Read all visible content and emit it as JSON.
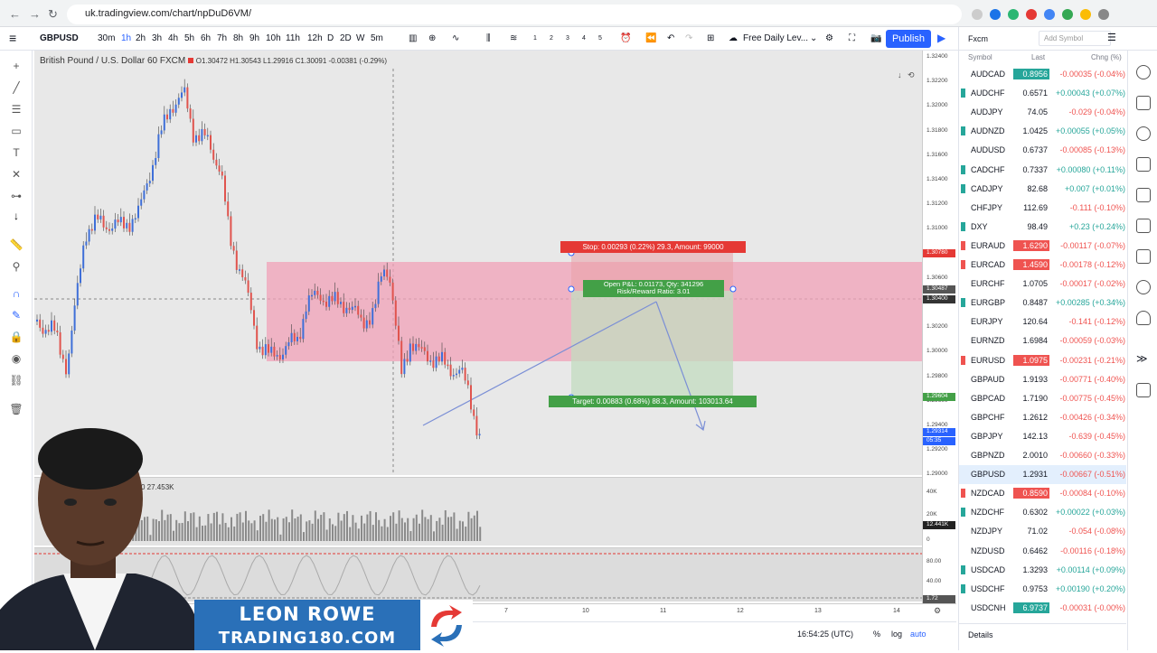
{
  "browser": {
    "url": "uk.tradingview.com/chart/npDuD6VM/"
  },
  "toolbar": {
    "symbol": "GBPUSD",
    "intervals": [
      "30m",
      "1h",
      "2h",
      "3h",
      "4h",
      "5h",
      "6h",
      "7h",
      "8h",
      "9h",
      "10h",
      "11h",
      "12h",
      "D",
      "2D",
      "W",
      "5m"
    ],
    "mini_numbers": [
      "1",
      "2",
      "3",
      "4",
      "5"
    ],
    "layout_name": "Free Daily Lev...",
    "publish": "Publish"
  },
  "chart": {
    "title": "British Pound / U.S. Dollar",
    "interval": "60",
    "exchange": "FXCM",
    "ohlc": "O1.30472 H1.30543 L1.29916 C1.30091 -0.00381 (-0.29%)",
    "stop_label": "Stop: 0.00293 (0.22%) 29.3, Amount: 99000",
    "pnl_label": "Open P&L: 0.01173, Qty: 341296",
    "rr_label": "Risk/Reward Ratio: 3.01",
    "target_label": "Target: 0.00883 (0.68%) 88.3, Amount: 103013.64",
    "volume_label": "D 0 27.453K"
  },
  "yaxis": {
    "ticks": [
      "1.32400",
      "1.32200",
      "1.32000",
      "1.31800",
      "1.31600",
      "1.31400",
      "1.31200",
      "1.31000",
      "1.30800",
      "1.30600",
      "1.30400",
      "1.30200",
      "1.30000",
      "1.29800",
      "1.29600",
      "1.29400",
      "1.29200",
      "1.29000"
    ],
    "stop_badge": "1.30780",
    "entry_badge": "1.30487",
    "cross_badge": "1.30400",
    "target_badge": "1.29604",
    "price_badge": "1.29314",
    "countdown": "05:35",
    "vol_ticks": [
      "40K",
      "20K",
      "0"
    ],
    "vol_badge": "12.441K",
    "osc_ticks": [
      "80.00",
      "40.00",
      "1.72"
    ]
  },
  "xaxis": {
    "ticks": [
      "7",
      "10",
      "11",
      "12",
      "13",
      "14"
    ]
  },
  "status": {
    "time": "16:54:25 (UTC)",
    "pct": "%",
    "log": "log",
    "auto": "auto"
  },
  "watchlist": {
    "title": "Fxcm",
    "add": "Add Symbol",
    "col_symbol": "Symbol",
    "col_last": "Last",
    "col_chng": "Chng (%)",
    "details": "Details",
    "rows": [
      {
        "s": "AUDCAD",
        "l": "0.8956",
        "c": "-0.00035 (-0.04%)",
        "d": "dn",
        "hl": "up"
      },
      {
        "s": "AUDCHF",
        "l": "0.6571",
        "c": "+0.00043 (+0.07%)",
        "d": "up",
        "hl": ""
      },
      {
        "s": "AUDJPY",
        "l": "74.05",
        "c": "-0.029 (-0.04%)",
        "d": "dn",
        "hl": ""
      },
      {
        "s": "AUDNZD",
        "l": "1.0425",
        "c": "+0.00055 (+0.05%)",
        "d": "up",
        "hl": ""
      },
      {
        "s": "AUDUSD",
        "l": "0.6737",
        "c": "-0.00085 (-0.13%)",
        "d": "dn",
        "hl": ""
      },
      {
        "s": "CADCHF",
        "l": "0.7337",
        "c": "+0.00080 (+0.11%)",
        "d": "up",
        "hl": ""
      },
      {
        "s": "CADJPY",
        "l": "82.68",
        "c": "+0.007 (+0.01%)",
        "d": "up",
        "hl": ""
      },
      {
        "s": "CHFJPY",
        "l": "112.69",
        "c": "-0.111 (-0.10%)",
        "d": "dn",
        "hl": ""
      },
      {
        "s": "DXY",
        "l": "98.49",
        "c": "+0.23 (+0.24%)",
        "d": "up",
        "hl": ""
      },
      {
        "s": "EURAUD",
        "l": "1.6290",
        "c": "-0.00117 (-0.07%)",
        "d": "dn",
        "hl": "dn"
      },
      {
        "s": "EURCAD",
        "l": "1.4590",
        "c": "-0.00178 (-0.12%)",
        "d": "dn",
        "hl": "dn"
      },
      {
        "s": "EURCHF",
        "l": "1.0705",
        "c": "-0.00017 (-0.02%)",
        "d": "dn",
        "hl": ""
      },
      {
        "s": "EURGBP",
        "l": "0.8487",
        "c": "+0.00285 (+0.34%)",
        "d": "up",
        "hl": ""
      },
      {
        "s": "EURJPY",
        "l": "120.64",
        "c": "-0.141 (-0.12%)",
        "d": "dn",
        "hl": ""
      },
      {
        "s": "EURNZD",
        "l": "1.6984",
        "c": "-0.00059 (-0.03%)",
        "d": "dn",
        "hl": ""
      },
      {
        "s": "EURUSD",
        "l": "1.0975",
        "c": "-0.00231 (-0.21%)",
        "d": "dn",
        "hl": "dn"
      },
      {
        "s": "GBPAUD",
        "l": "1.9193",
        "c": "-0.00771 (-0.40%)",
        "d": "dn",
        "hl": ""
      },
      {
        "s": "GBPCAD",
        "l": "1.7190",
        "c": "-0.00775 (-0.45%)",
        "d": "dn",
        "hl": ""
      },
      {
        "s": "GBPCHF",
        "l": "1.2612",
        "c": "-0.00426 (-0.34%)",
        "d": "dn",
        "hl": ""
      },
      {
        "s": "GBPJPY",
        "l": "142.13",
        "c": "-0.639 (-0.45%)",
        "d": "dn",
        "hl": ""
      },
      {
        "s": "GBPNZD",
        "l": "2.0010",
        "c": "-0.00660 (-0.33%)",
        "d": "dn",
        "hl": ""
      },
      {
        "s": "GBPUSD",
        "l": "1.2931",
        "c": "-0.00667 (-0.51%)",
        "d": "dn",
        "hl": ""
      },
      {
        "s": "NZDCAD",
        "l": "0.8590",
        "c": "-0.00084 (-0.10%)",
        "d": "dn",
        "hl": "dn"
      },
      {
        "s": "NZDCHF",
        "l": "0.6302",
        "c": "+0.00022 (+0.03%)",
        "d": "up",
        "hl": ""
      },
      {
        "s": "NZDJPY",
        "l": "71.02",
        "c": "-0.054 (-0.08%)",
        "d": "dn",
        "hl": ""
      },
      {
        "s": "NZDUSD",
        "l": "0.6462",
        "c": "-0.00116 (-0.18%)",
        "d": "dn",
        "hl": ""
      },
      {
        "s": "USDCAD",
        "l": "1.3293",
        "c": "+0.00114 (+0.09%)",
        "d": "up",
        "hl": ""
      },
      {
        "s": "USDCHF",
        "l": "0.9753",
        "c": "+0.00190 (+0.20%)",
        "d": "up",
        "hl": ""
      },
      {
        "s": "USDCNH",
        "l": "6.9737",
        "c": "-0.00031 (-0.00%)",
        "d": "dn",
        "hl": "up"
      }
    ]
  },
  "overlay": {
    "name": "LEON ROWE",
    "site": "TRADING180.COM"
  }
}
